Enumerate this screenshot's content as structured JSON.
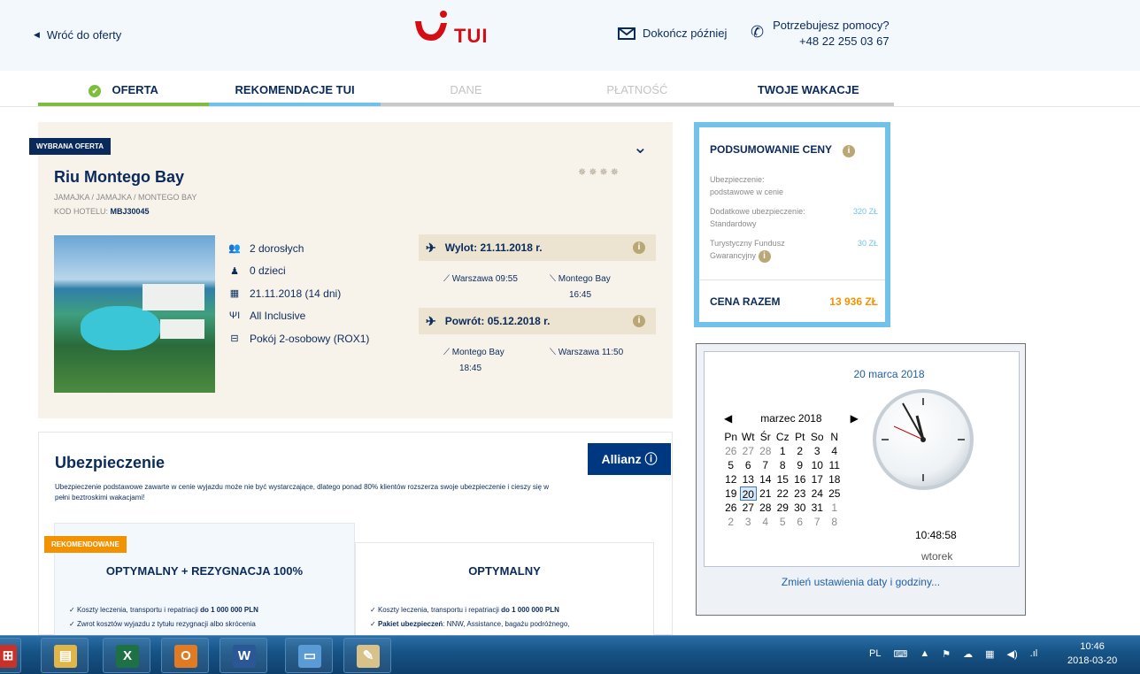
{
  "header": {
    "back": "Wróć do oferty",
    "logo": "TUI",
    "finish_later": "Dokończ później",
    "help_title": "Potrzebujesz pomocy?",
    "help_phone": "+48 22 255 03 67"
  },
  "steps": [
    {
      "label": "OFERTA"
    },
    {
      "label": "REKOMENDACJE TUI"
    },
    {
      "label": "DANE"
    },
    {
      "label": "PŁATNOŚĆ"
    },
    {
      "label": "TWOJE WAKACJE"
    }
  ],
  "offer": {
    "badge": "WYBRANA OFERTA",
    "hotel": "Riu Montego Bay",
    "location": "JAMAJKA / JAMAJKA / MONTEGO BAY",
    "code_label": "KOD HOTELU:",
    "code": "MBJ30045",
    "stars": "✵✵✵✵",
    "details": [
      {
        "icon": "adults-icon",
        "glyph": "👥",
        "text": "2 dorosłych"
      },
      {
        "icon": "child-icon",
        "glyph": "♟",
        "text": "0 dzieci"
      },
      {
        "icon": "calendar-icon",
        "glyph": "▦",
        "text": "21.11.2018 (14 dni)"
      },
      {
        "icon": "food-icon",
        "glyph": "ΨI",
        "text": "All Inclusive"
      },
      {
        "icon": "bed-icon",
        "glyph": "⊟",
        "text": "Pokój 2-osobowy (ROX1)"
      }
    ],
    "outbound": {
      "title": "Wylot: 21.11.2018 r.",
      "from": "Warszawa 09:55",
      "to_city": "Montego Bay",
      "to_time": "16:45"
    },
    "return": {
      "title": "Powrót: 05.12.2018 r.",
      "from_city": "Montego Bay",
      "from_time": "18:45",
      "to": "Warszawa 11:50"
    }
  },
  "insurance": {
    "title": "Ubezpieczenie",
    "desc": "Ubezpieczenie podstawowe zawarte w cenie wyjazdu może nie być wystarczające, dlatego ponad 80% klientów rozszerza swoje ubezpieczenie i cieszy się w pełni beztroskimi wakacjami!",
    "partner": "Allianz ⓘ",
    "card1": {
      "badge": "REKOMENDOWANE",
      "title": "OPTYMALNY + REZYGNACJA 100%",
      "f1": "Koszty leczenia, transportu i repatriacji",
      "f1b": "do 1 000 000 PLN",
      "f2": "Zwrot kosztów wyjazdu z tytułu rezygnacji albo skrócenia"
    },
    "card2": {
      "title": "OPTYMALNY",
      "f1": "Koszty leczenia, transportu i repatriacji",
      "f1b": "do 1 000 000 PLN",
      "f2b": "Pakiet ubezpieczeń",
      "f2": ": NNW, Assistance, bagażu podróżnego,"
    }
  },
  "summary": {
    "title": "PODSUMOWANIE CENY",
    "l1a": "Ubezpieczenie:",
    "l1b": "podstawowe w cenie",
    "l2a": "Dodatkowe ubezpieczenie:",
    "l2b": "Standardowy",
    "l2p": "320 ZŁ",
    "l3a": "Turystyczny Fundusz",
    "l3b": "Gwarancyjny",
    "l3p": "30 ZŁ",
    "total_label": "CENA RAZEM",
    "total": "13 936 ZŁ"
  },
  "clock": {
    "date": "20 marca 2018",
    "month": "marzec 2018",
    "days": [
      "Pn",
      "Wt",
      "Śr",
      "Cz",
      "Pt",
      "So",
      "N"
    ],
    "weeks": [
      [
        "26",
        "27",
        "28",
        "1",
        "2",
        "3",
        "4"
      ],
      [
        "5",
        "6",
        "7",
        "8",
        "9",
        "10",
        "11"
      ],
      [
        "12",
        "13",
        "14",
        "15",
        "16",
        "17",
        "18"
      ],
      [
        "19",
        "20",
        "21",
        "22",
        "23",
        "24",
        "25"
      ],
      [
        "26",
        "27",
        "28",
        "29",
        "30",
        "31",
        "1"
      ],
      [
        "2",
        "3",
        "4",
        "5",
        "6",
        "7",
        "8"
      ]
    ],
    "time": "10:48:58",
    "weekday": "wtorek",
    "link": "Zmień ustawienia daty i godziny..."
  },
  "taskbar": {
    "lang": "PL",
    "time": "10:46",
    "date": "2018-03-20",
    "apps": [
      "explorer-icon",
      "excel-icon",
      "outlook-icon",
      "word-icon",
      "photos-icon",
      "paint-icon"
    ]
  },
  "colors": {
    "navy": "#0a2a5c",
    "red": "#d40e14",
    "green": "#7fbe3c",
    "blue": "#70c2ea",
    "orange": "#f39200"
  }
}
